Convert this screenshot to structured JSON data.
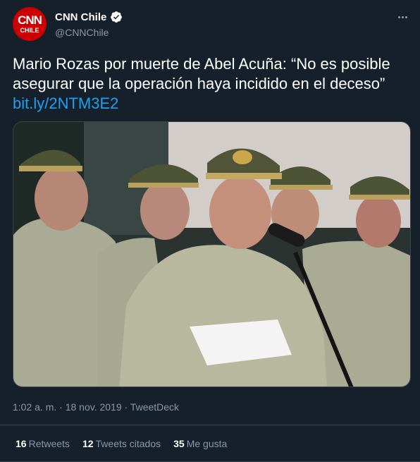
{
  "author": {
    "display_name": "CNN Chile",
    "handle": "@CNNChile",
    "verified": true,
    "avatar_logo": "CNN",
    "avatar_logo_sub": "CHILE"
  },
  "tweet": {
    "text": "Mario Rozas por muerte de Abel Acuña: “No es posible asegurar que la operación haya incidido en el deceso”",
    "link": "bit.ly/2NTM3E2",
    "timestamp": "1:02 a. m. · 18 nov. 2019 · TweetDeck"
  },
  "stats": {
    "retweets_count": "16",
    "retweets_label": "Retweets",
    "quotes_count": "12",
    "quotes_label": "Tweets citados",
    "likes_count": "35",
    "likes_label": "Me gusta"
  },
  "icons": {
    "verified": "verified-badge-icon",
    "more": "more-options-icon"
  },
  "colors": {
    "background": "#15202b",
    "text": "#ffffff",
    "secondary": "#8899a6",
    "link": "#1da1f2",
    "brand": "#cc0000"
  }
}
